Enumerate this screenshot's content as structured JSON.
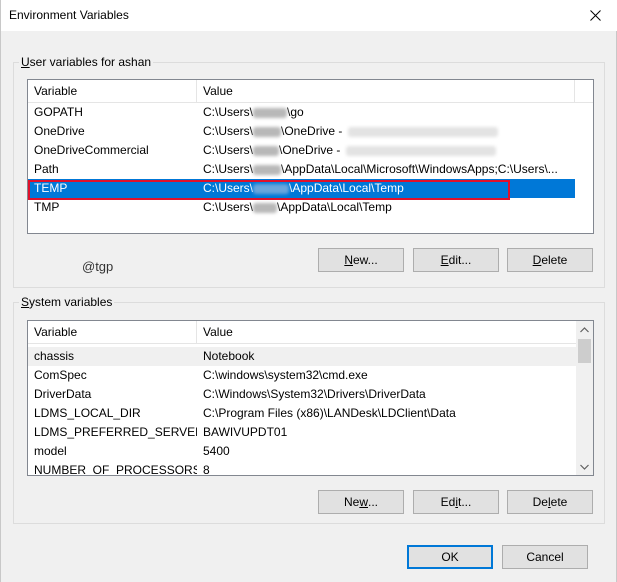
{
  "window": {
    "title": "Environment Variables"
  },
  "user_group": {
    "label_prefix": "U",
    "label_rest": "ser variables for ashan"
  },
  "user_columns": [
    "Variable",
    "Value"
  ],
  "user_rows": [
    {
      "variable": "GOPATH",
      "value_before": "C:\\Users\\",
      "value_after": "\\go"
    },
    {
      "variable": "OneDrive",
      "value_before": "C:\\Users\\",
      "value_after": "\\OneDrive -"
    },
    {
      "variable": "OneDriveCommercial",
      "value_before": "C:\\Users\\",
      "value_after": "\\OneDrive -"
    },
    {
      "variable": "Path",
      "value_before": "C:\\Users\\",
      "value_after": "\\AppData\\Local\\Microsoft\\WindowsApps;C:\\Users\\..."
    },
    {
      "variable": "TEMP",
      "value_before": "C:\\Users\\",
      "value_after": "\\AppData\\Local\\Temp"
    },
    {
      "variable": "TMP",
      "value_before": "C:\\Users\\",
      "value_after": "\\AppData\\Local\\Temp"
    }
  ],
  "user_selected_index": 4,
  "user_buttons": {
    "new": {
      "u": "N",
      "rest": "ew..."
    },
    "edit": {
      "u": "E",
      "rest": "dit..."
    },
    "delete": {
      "u": "D",
      "rest": "elete"
    }
  },
  "watermark": "@tgp",
  "system_group": {
    "label_prefix": "S",
    "label_rest": "ystem variables"
  },
  "system_columns": [
    "Variable",
    "Value"
  ],
  "system_rows": [
    {
      "variable": "chassis",
      "value": "Notebook"
    },
    {
      "variable": "ComSpec",
      "value": "C:\\windows\\system32\\cmd.exe"
    },
    {
      "variable": "DriverData",
      "value": "C:\\Windows\\System32\\Drivers\\DriverData"
    },
    {
      "variable": "LDMS_LOCAL_DIR",
      "value": "C:\\Program Files (x86)\\LANDesk\\LDClient\\Data"
    },
    {
      "variable": "LDMS_PREFERRED_SERVER",
      "value": "BAWIVUPDT01"
    },
    {
      "variable": "model",
      "value": "5400"
    },
    {
      "variable": "NUMBER_OF_PROCESSORS",
      "value": "8"
    }
  ],
  "system_hover_index": 0,
  "system_buttons": {
    "new": {
      "before": "Ne",
      "u": "w",
      "rest": "..."
    },
    "edit": {
      "before": "Ed",
      "u": "i",
      "rest": "t..."
    },
    "delete": {
      "before": "De",
      "u": "l",
      "rest": "ete"
    }
  },
  "footer": {
    "ok": "OK",
    "cancel": "Cancel"
  },
  "colors": {
    "selection": "#0078d7",
    "highlight_box": "#e0112b"
  }
}
